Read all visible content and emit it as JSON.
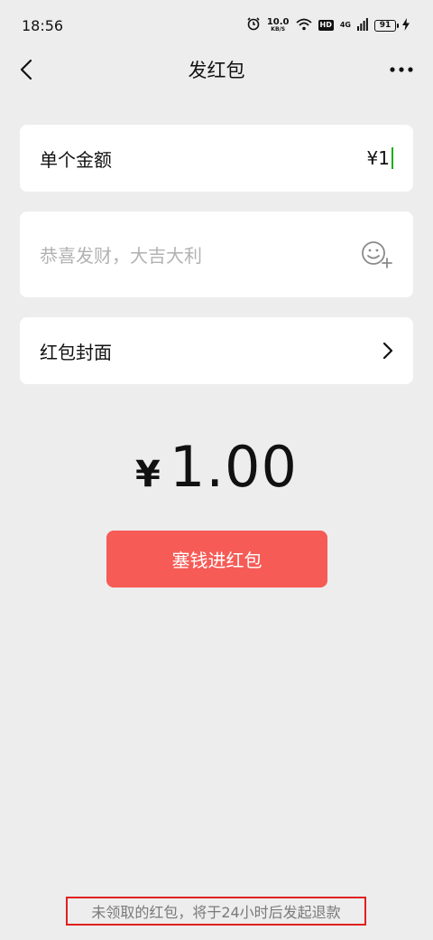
{
  "status_bar": {
    "time": "18:56",
    "net_speed_value": "10.0",
    "net_speed_unit": "KB/S",
    "hd_label": "HD",
    "network_label": "4G",
    "battery_level": "91"
  },
  "nav": {
    "title": "发红包"
  },
  "form": {
    "amount_label": "单个金额",
    "amount_value": "¥1",
    "greeting_placeholder": "恭喜发财，大吉大利",
    "cover_label": "红包封面"
  },
  "summary": {
    "currency_symbol": "¥",
    "total_amount": "1.00"
  },
  "actions": {
    "submit_label": "塞钱进红包"
  },
  "footer": {
    "refund_note": "未领取的红包，将于24小时后发起退款"
  },
  "colors": {
    "background": "#ededed",
    "primary_button": "#f65b56",
    "caret": "#1aad19",
    "highlight_box": "#e02020"
  }
}
